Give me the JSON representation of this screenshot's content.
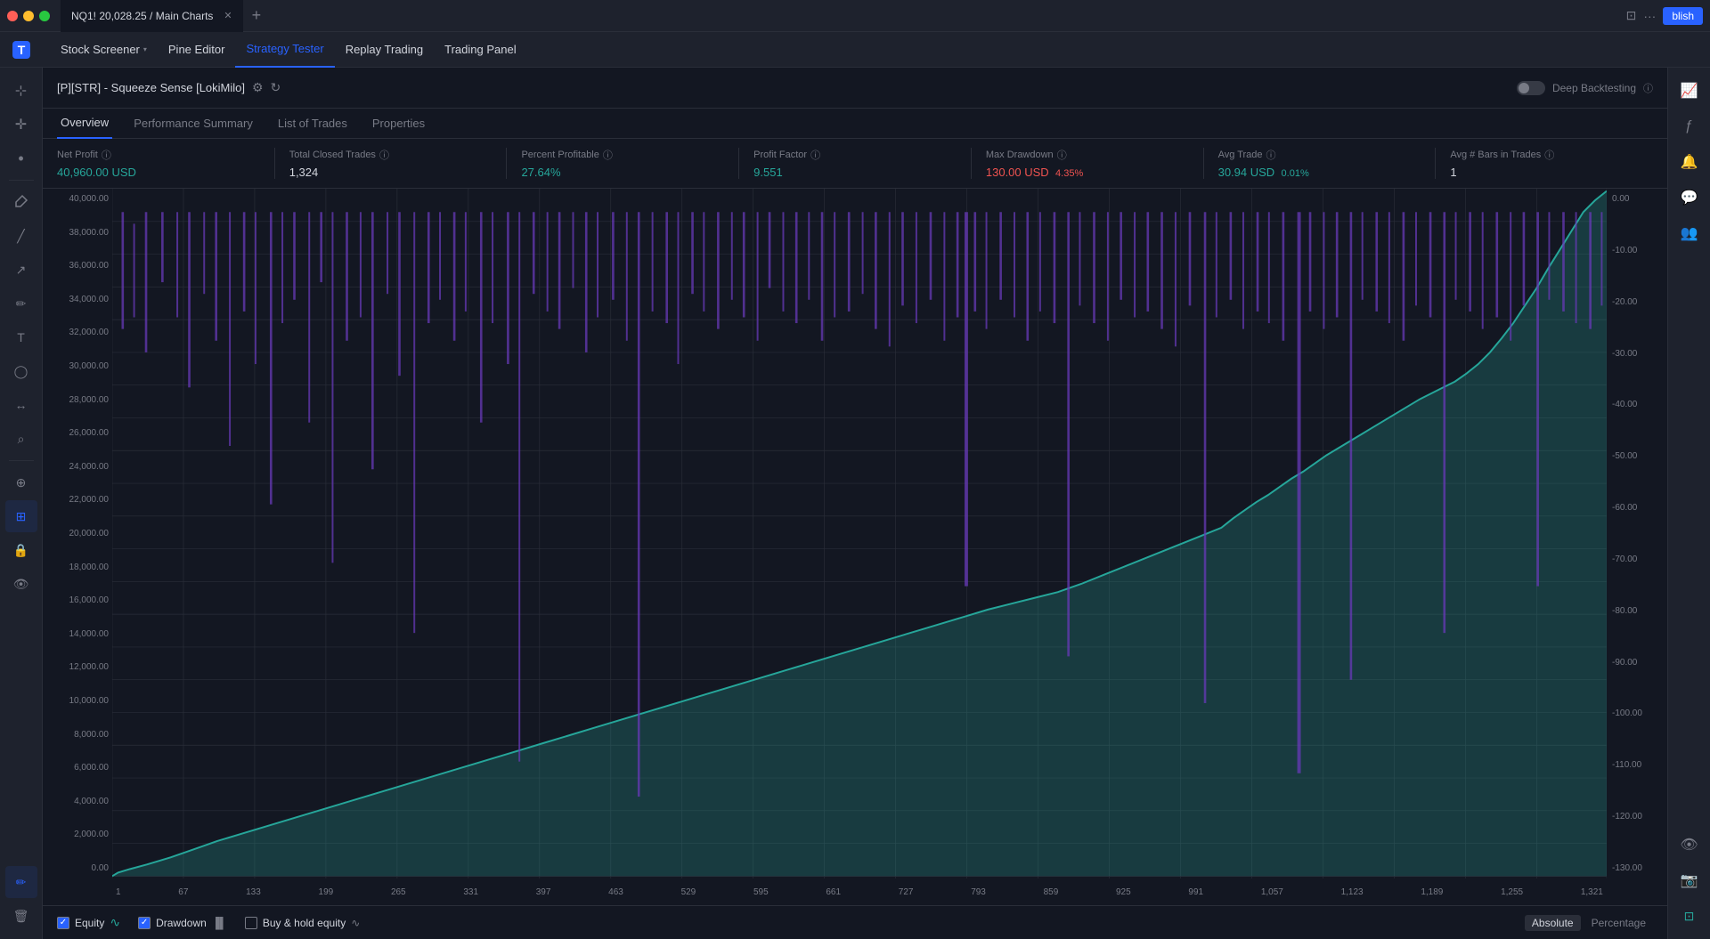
{
  "window": {
    "tab_title": "NQ1! 20,028.25 / Main Charts",
    "new_tab_icon": "+"
  },
  "topbar_right": {
    "restore_icon": "⊡",
    "more_icon": "···"
  },
  "navbar": {
    "items": [
      {
        "id": "stock-screener",
        "label": "Stock Screener",
        "has_arrow": true,
        "active": false
      },
      {
        "id": "pine-editor",
        "label": "Pine Editor",
        "has_arrow": false,
        "active": false
      },
      {
        "id": "strategy-tester",
        "label": "Strategy Tester",
        "has_arrow": false,
        "active": true
      },
      {
        "id": "replay-trading",
        "label": "Replay Trading",
        "has_arrow": false,
        "active": false
      },
      {
        "id": "trading-panel",
        "label": "Trading Panel",
        "has_arrow": false,
        "active": false
      }
    ],
    "publish_btn": "blish"
  },
  "panel": {
    "title": "[P][STR] - Squeeze Sense [LokiMilo]",
    "deep_backtesting_label": "Deep Backtesting",
    "info_label": "ⓘ"
  },
  "tabs": [
    {
      "id": "overview",
      "label": "Overview",
      "active": true
    },
    {
      "id": "performance-summary",
      "label": "Performance Summary",
      "active": false
    },
    {
      "id": "list-of-trades",
      "label": "List of Trades",
      "active": false
    },
    {
      "id": "properties",
      "label": "Properties",
      "active": false
    }
  ],
  "stats": [
    {
      "id": "net-profit",
      "label": "Net Profit",
      "value": "40,960.00 USD",
      "value_class": "green",
      "secondary": null
    },
    {
      "id": "total-closed-trades",
      "label": "Total Closed Trades",
      "value": "1,324",
      "value_class": "normal",
      "secondary": null
    },
    {
      "id": "percent-profitable",
      "label": "Percent Profitable",
      "value": "27.64%",
      "value_class": "green",
      "secondary": null
    },
    {
      "id": "profit-factor",
      "label": "Profit Factor",
      "value": "9.551",
      "value_class": "green",
      "secondary": null
    },
    {
      "id": "max-drawdown",
      "label": "Max Drawdown",
      "value": "130.00 USD",
      "value_class": "red",
      "secondary": "4.35%"
    },
    {
      "id": "avg-trade",
      "label": "Avg Trade",
      "value": "30.94 USD",
      "value_class": "green",
      "secondary": "0.01%"
    },
    {
      "id": "avg-bars-in-trades",
      "label": "Avg # Bars in Trades",
      "value": "1",
      "value_class": "normal",
      "secondary": null
    }
  ],
  "chart": {
    "y_labels_left": [
      "40,000.00",
      "38,000.00",
      "36,000.00",
      "34,000.00",
      "32,000.00",
      "30,000.00",
      "28,000.00",
      "26,000.00",
      "24,000.00",
      "22,000.00",
      "20,000.00",
      "18,000.00",
      "16,000.00",
      "14,000.00",
      "12,000.00",
      "10,000.00",
      "8,000.00",
      "6,000.00",
      "4,000.00",
      "2,000.00",
      "0.00"
    ],
    "y_labels_right": [
      "0.00",
      "-10.00",
      "-20.00",
      "-30.00",
      "-40.00",
      "-50.00",
      "-60.00",
      "-70.00",
      "-80.00",
      "-90.00",
      "-100.00",
      "-110.00",
      "-120.00",
      "-130.00"
    ],
    "x_labels": [
      "1",
      "67",
      "133",
      "199",
      "265",
      "331",
      "397",
      "463",
      "529",
      "595",
      "661",
      "727",
      "793",
      "859",
      "925",
      "991",
      "1,057",
      "1,123",
      "1,189",
      "1,255",
      "1,321"
    ]
  },
  "legend": [
    {
      "id": "equity",
      "label": "Equity",
      "checked": true,
      "icon": "∿"
    },
    {
      "id": "drawdown",
      "label": "Drawdown",
      "checked": true,
      "icon": "▐▌"
    },
    {
      "id": "buy-hold-equity",
      "label": "Buy & hold equity",
      "checked": false,
      "icon": "∿"
    }
  ],
  "bottom_buttons": [
    {
      "id": "absolute",
      "label": "Absolute",
      "active": true
    },
    {
      "id": "percentage",
      "label": "Percentage",
      "active": false
    }
  ],
  "left_sidebar": {
    "icons": [
      {
        "id": "cursor",
        "symbol": "⊹",
        "active": false
      },
      {
        "id": "crosshair",
        "symbol": "✛",
        "active": false
      },
      {
        "id": "dot",
        "symbol": "·",
        "active": false
      },
      {
        "id": "eraser",
        "symbol": "⌫",
        "active": false
      },
      {
        "id": "line",
        "symbol": "╱",
        "active": false
      },
      {
        "id": "trend",
        "symbol": "↗",
        "active": false
      },
      {
        "id": "pen",
        "symbol": "✏",
        "active": false
      },
      {
        "id": "text",
        "symbol": "T",
        "active": false
      },
      {
        "id": "shapes",
        "symbol": "◯",
        "active": false
      },
      {
        "id": "measure",
        "symbol": "↔",
        "active": false
      },
      {
        "id": "zoom",
        "symbol": "⌕",
        "active": false
      },
      {
        "id": "magnet",
        "symbol": "⊕",
        "active": true
      },
      {
        "id": "indicator",
        "symbol": "⊞",
        "active": false
      },
      {
        "id": "lock",
        "symbol": "🔒",
        "active": false
      },
      {
        "id": "eye",
        "symbol": "👁",
        "active": false
      },
      {
        "id": "draw-active",
        "symbol": "✏",
        "active": true
      },
      {
        "id": "trash",
        "symbol": "🗑",
        "active": false
      }
    ]
  },
  "right_sidebar": {
    "icons": [
      {
        "id": "chart-type",
        "symbol": "📈"
      },
      {
        "id": "indicators",
        "symbol": "ƒ"
      },
      {
        "id": "alerts",
        "symbol": "🔔"
      },
      {
        "id": "chat",
        "symbol": "💬"
      },
      {
        "id": "community",
        "symbol": "👥"
      },
      {
        "id": "watch",
        "symbol": "👁"
      },
      {
        "id": "camera",
        "symbol": "📷"
      },
      {
        "id": "fullscreen",
        "symbol": "⊡"
      }
    ]
  },
  "colors": {
    "bg": "#131722",
    "panel_bg": "#1e222d",
    "border": "#2a2e39",
    "accent": "#2962ff",
    "green": "#26a69a",
    "red": "#ef5350",
    "purple": "#673ab7",
    "text": "#d1d4dc",
    "muted": "#787b86"
  }
}
